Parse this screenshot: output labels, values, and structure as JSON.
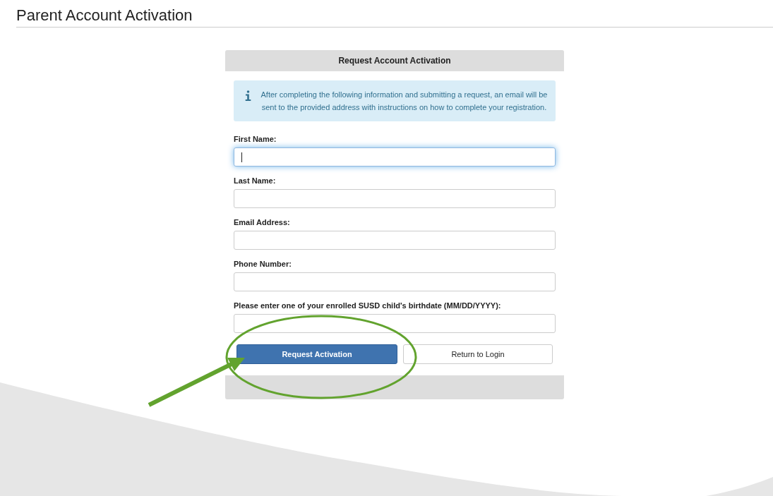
{
  "page": {
    "title": "Parent Account Activation"
  },
  "card": {
    "title": "Request Account Activation",
    "notice": "After completing the following information and submitting a request, an email will be sent to the provided address with instructions on how to complete your registration.",
    "fields": [
      {
        "label": "First Name:",
        "focused": true
      },
      {
        "label": "Last Name:",
        "focused": false
      },
      {
        "label": "Email Address:",
        "focused": false
      },
      {
        "label": "Phone Number:",
        "focused": false
      },
      {
        "label": "Please enter one of your enrolled SUSD child's birthdate (MM/DD/YYYY):",
        "focused": false
      }
    ],
    "buttons": [
      {
        "label": "Request Activation",
        "kind": "primary"
      },
      {
        "label": "Return to Login",
        "kind": "secondary"
      }
    ]
  }
}
